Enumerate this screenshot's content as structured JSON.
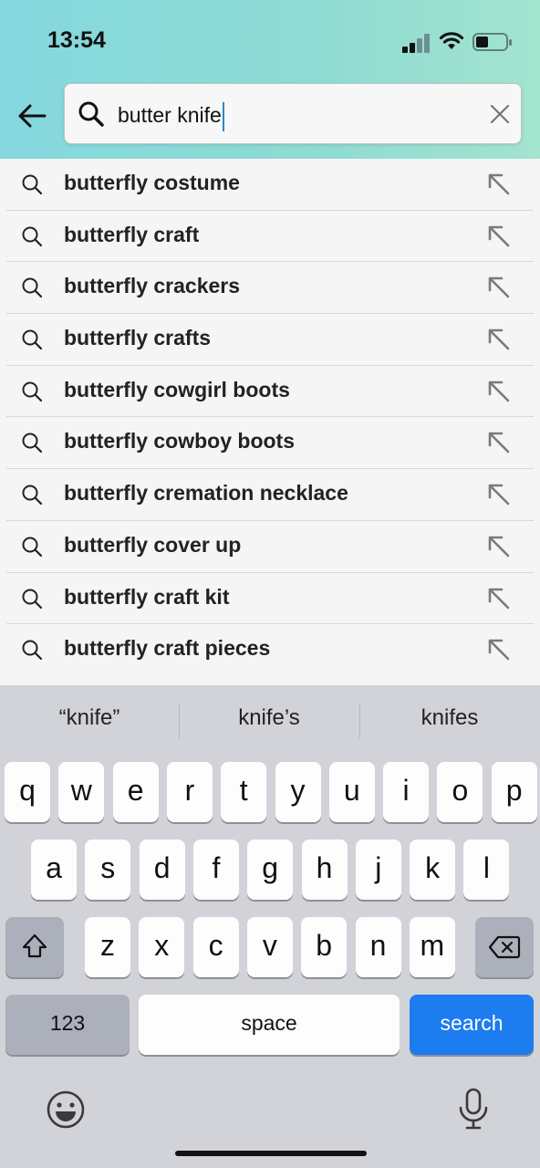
{
  "status_bar": {
    "time": "13:54"
  },
  "search": {
    "query": "butter knife"
  },
  "suggestions": [
    "butterfly costume",
    "butterfly craft",
    "butterfly crackers",
    "butterfly crafts",
    "butterfly cowgirl boots",
    "butterfly cowboy boots",
    "butterfly cremation necklace",
    "butterfly cover up",
    "butterfly craft kit",
    "butterfly craft pieces"
  ],
  "keyboard": {
    "predictions": [
      "“knife”",
      "knife’s",
      "knifes"
    ],
    "row1": [
      "q",
      "w",
      "e",
      "r",
      "t",
      "y",
      "u",
      "i",
      "o",
      "p"
    ],
    "row2": [
      "a",
      "s",
      "d",
      "f",
      "g",
      "h",
      "j",
      "k",
      "l"
    ],
    "row3": [
      "z",
      "x",
      "c",
      "v",
      "b",
      "n",
      "m"
    ],
    "numbers_label": "123",
    "space_label": "space",
    "search_label": "search"
  },
  "colors": {
    "header_gradient_start": "#84d8de",
    "header_gradient_end": "#a3e4cf",
    "search_key": "#1c7cf0",
    "caret": "#2a86c8"
  },
  "icons": [
    "signal-icon",
    "wifi-icon",
    "battery-icon",
    "back-arrow-icon",
    "search-icon",
    "clear-icon",
    "fill-arrow-icon",
    "shift-icon",
    "backspace-icon",
    "emoji-icon",
    "microphone-icon"
  ]
}
